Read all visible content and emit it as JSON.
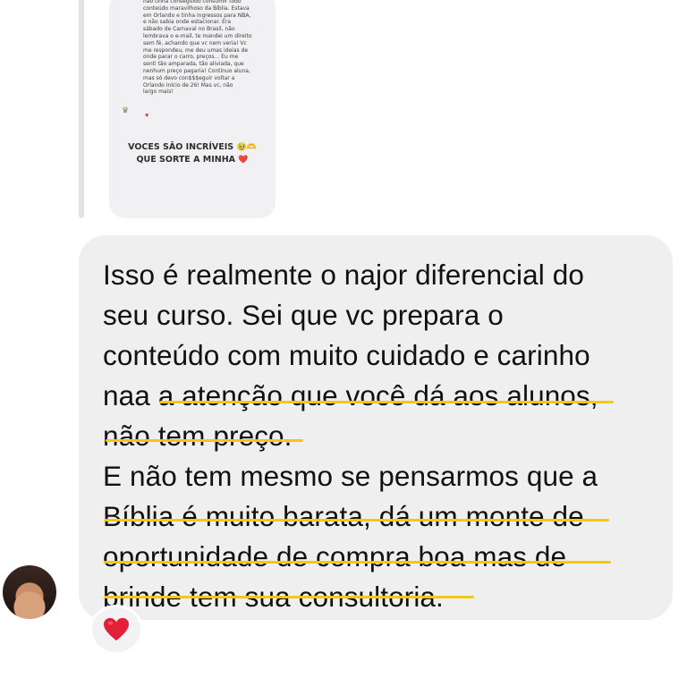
{
  "quoted_story": {
    "text": "não tinha conseguido consumir todo\nconteúdo maravilhoso da Bíblia. Estava\nem Orlando e tinha ingressos para NBA,\ne não sabia onde estacionar. Era\nsábado de Carnaval no Brasil, não\nlembrava o e-mail, te mandei um direito\nsem fé, achando que vc nem veria! Vc\nme respondeu, me deu umas ideias de\nonde parar o carro, preços... Eu me\nsenti tão amparada, tão aliviada, que\nnenhum preço pagaria! Continuo aluna,\nmas só devo con$$$eguir voltar a\nOrlando início de 26! Mas vc, não\nlargo mais!",
    "caption_line1": "VOCES SÃO INCRÍVEIS",
    "caption_line2": "QUE SORTE A MINHA",
    "caption_emoji1": "🥹🫶",
    "caption_emoji2": "❤️"
  },
  "message": {
    "lines": [
      "Isso é realmente o najor diferencial do",
      "seu curso. Sei que vc prepara o",
      "conteúdo com muito cuidado e carinho",
      "naa a atenção que você dá aos alunos,",
      "não tem preço.",
      "E não tem mesmo se pensarmos que a",
      "Bíblia é muito barata, dá um monte de",
      "oportunidade de compra boa mas de",
      "brinde tem sua consultoria."
    ]
  },
  "reaction": {
    "emoji": "heart",
    "color": "#e3203a"
  },
  "highlight_color": "#f5c518",
  "bubble_color": "#efefef"
}
